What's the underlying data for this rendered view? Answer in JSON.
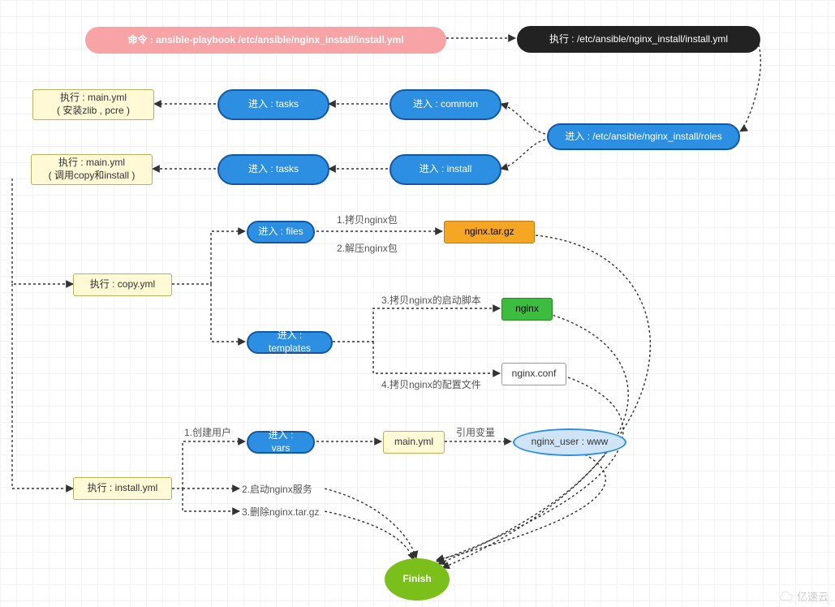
{
  "nodes": {
    "cmd": {
      "text": "命令 : ansible-playbook /etc/ansible/nginx_install/install.yml"
    },
    "runYml": {
      "text": "执行 : /etc/ansible/nginx_install/install.yml"
    },
    "roles": {
      "text": "进入 : /etc/ansible/nginx_install/roles"
    },
    "common": {
      "text": "进入 : common"
    },
    "install": {
      "text": "进入 : install"
    },
    "tasks1": {
      "text": "进入 : tasks"
    },
    "tasks2": {
      "text": "进入 : tasks"
    },
    "main1": {
      "text": "执行 : main.yml\n( 安装zlib , pcre )"
    },
    "main2": {
      "text": "执行 : main.yml\n( 调用copy和install )"
    },
    "copyYml": {
      "text": "执行 : copy.yml"
    },
    "installYml": {
      "text": "执行 : install.yml"
    },
    "files": {
      "text": "进入 : files"
    },
    "templates": {
      "text": "进入 : templates"
    },
    "vars": {
      "text": "进入 : vars"
    },
    "tar": {
      "text": "nginx.tar.gz"
    },
    "nginx": {
      "text": "nginx"
    },
    "conf": {
      "text": "nginx.conf"
    },
    "mainVars": {
      "text": "main.yml"
    },
    "user": {
      "text": "nginx_user : www"
    },
    "finish": {
      "text": "Finish"
    }
  },
  "labels": {
    "l1a": "1.拷贝nginx包",
    "l1b": "2.解压nginx包",
    "l3": "3.拷贝nginx的启动脚本",
    "l4": "4.拷贝nginx的配置文件",
    "cu": "1.创建用户",
    "sv": "2.启动nginx服务",
    "rm": "3.删除nginx.tar.gz",
    "ref": "引用变量"
  },
  "watermark": "亿速云"
}
